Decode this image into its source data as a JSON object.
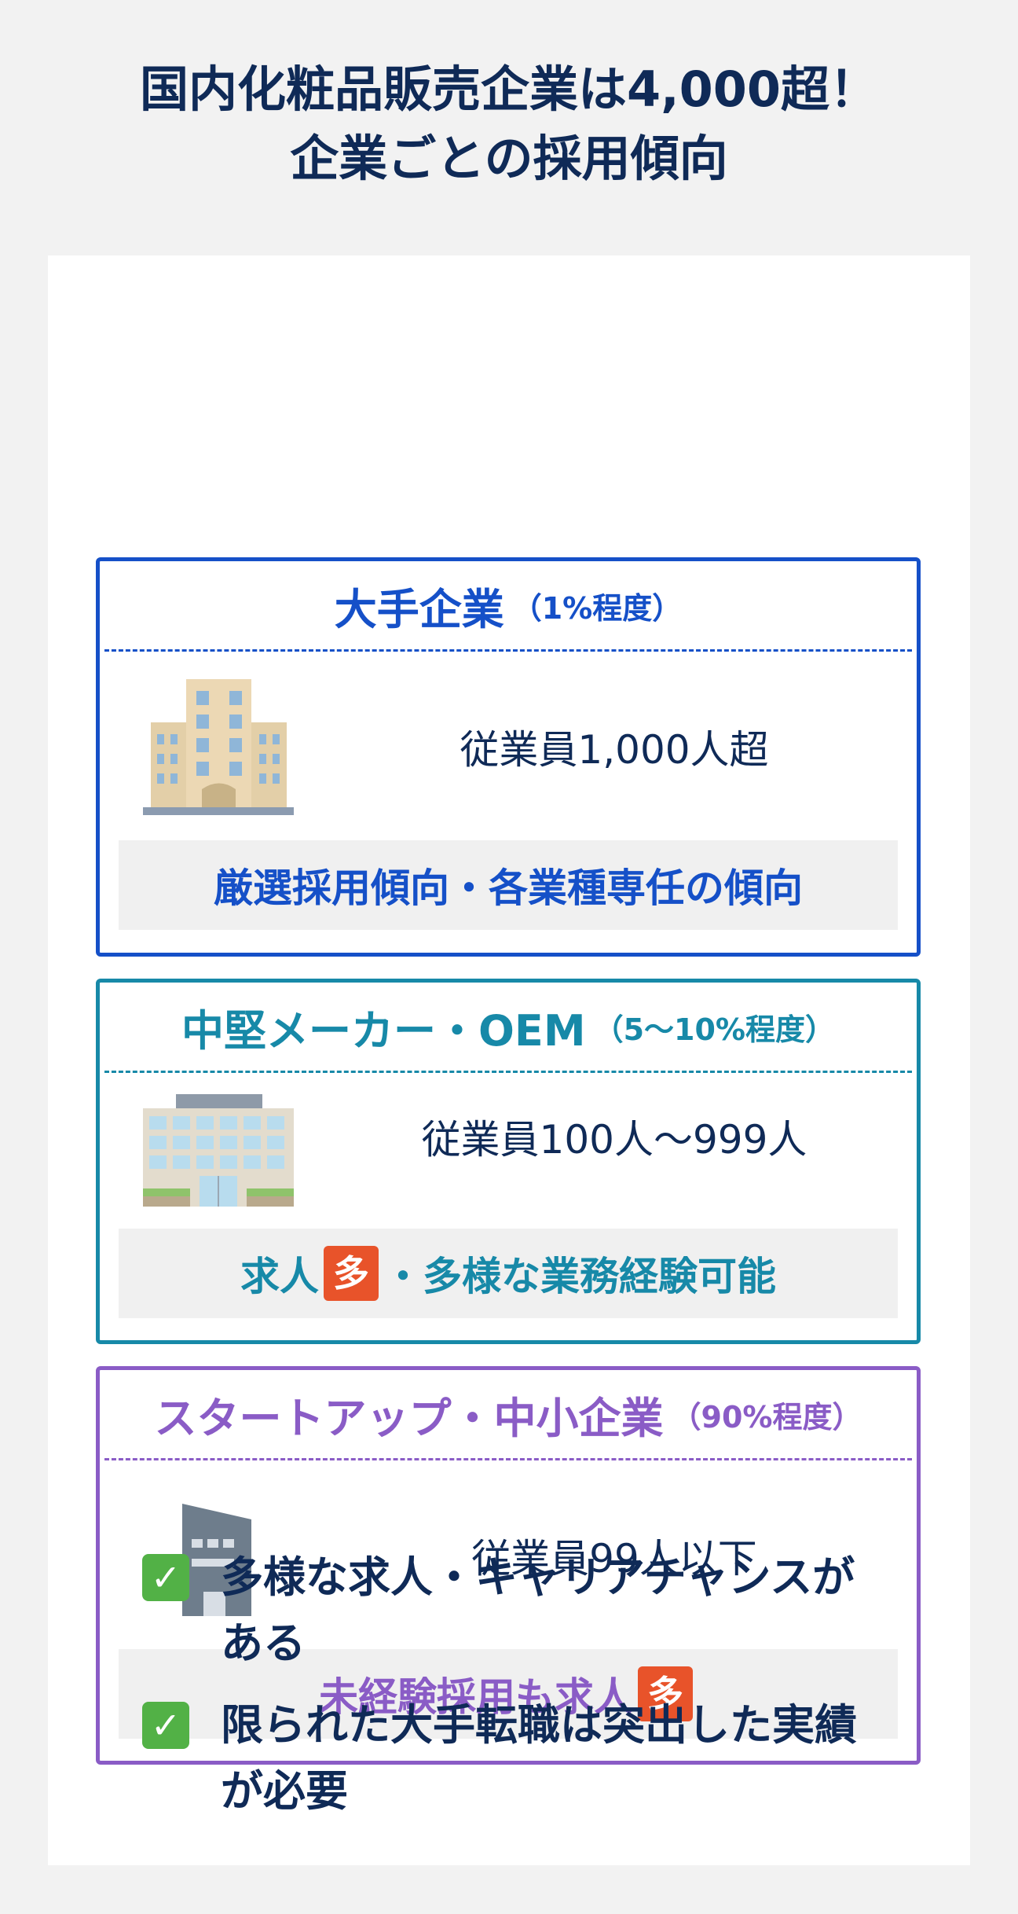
{
  "title": {
    "line1": "国内化粧品販売企業は4,000超！",
    "line2": "企業ごとの採用傾向"
  },
  "cards": [
    {
      "name": "大手企業",
      "percent": "（1%程度）",
      "employees": "従業員1,000人超",
      "trend": "厳選採用傾向・各業種専任の傾向",
      "color": "#1550c8",
      "icon": "large-office-building-icon"
    },
    {
      "name": "中堅メーカー・OEM",
      "percent": "（5〜10%程度）",
      "employees": "従業員100人〜999人",
      "trend_before": "求人",
      "trend_badge": "多",
      "trend_after": "・多様な業務経験可能",
      "color": "#1789a8",
      "icon": "mid-size-office-building-icon"
    },
    {
      "name": "スタートアップ・中小企業",
      "percent": "（90%程度）",
      "employees": "従業員99人以下",
      "trend_before": "未経験採用も求人",
      "trend_badge": "多",
      "color": "#8a5cc6",
      "icon": "small-office-building-icon"
    }
  ],
  "badge_color": "#e8532a",
  "checklist": [
    {
      "line1": "多様な求人・キャリアチャンスが",
      "line2": "ある",
      "icon": "check-mark-icon"
    },
    {
      "line1": "限られた大手転職は突出した実績",
      "line2": "が必要",
      "icon": "check-mark-icon"
    }
  ]
}
